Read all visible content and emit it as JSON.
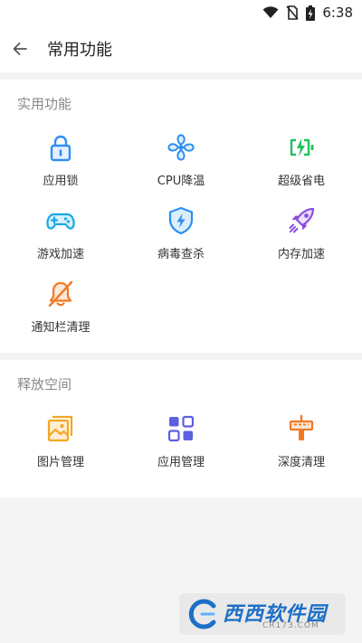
{
  "status_bar": {
    "time": "6:38"
  },
  "header": {
    "title": "常用功能"
  },
  "sections": [
    {
      "title": "实用功能",
      "items": [
        {
          "label": "应用锁",
          "icon": "lock-icon",
          "color": "#2f8ff0"
        },
        {
          "label": "CPU降温",
          "icon": "fan-icon",
          "color": "#2f8ff0"
        },
        {
          "label": "超级省电",
          "icon": "battery-icon",
          "color": "#22c35e"
        },
        {
          "label": "游戏加速",
          "icon": "gamepad-icon",
          "color": "#1aa7e8"
        },
        {
          "label": "病毒查杀",
          "icon": "shield-icon",
          "color": "#2f8ff0"
        },
        {
          "label": "内存加速",
          "icon": "rocket-icon",
          "color": "#8a4fe0"
        },
        {
          "label": "通知栏清理",
          "icon": "bell-off-icon",
          "color": "#f07a24"
        }
      ]
    },
    {
      "title": "释放空间",
      "items": [
        {
          "label": "图片管理",
          "icon": "image-icon",
          "color": "#f5a623"
        },
        {
          "label": "应用管理",
          "icon": "app-grid-icon",
          "color": "#5b5fe0"
        },
        {
          "label": "深度清理",
          "icon": "broom-icon",
          "color": "#f07a24"
        }
      ]
    }
  ],
  "watermark": {
    "brand": "西西软件园",
    "site": "CR173.COM"
  }
}
